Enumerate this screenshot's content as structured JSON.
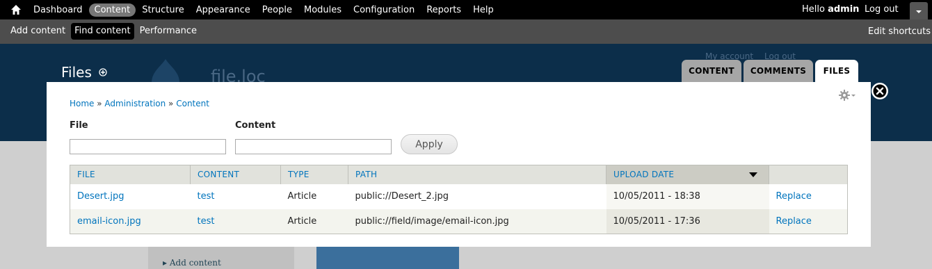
{
  "toolbar": {
    "menu": [
      "Dashboard",
      "Content",
      "Structure",
      "Appearance",
      "People",
      "Modules",
      "Configuration",
      "Reports",
      "Help"
    ],
    "active_index": 1,
    "hello": "Hello ",
    "username": "admin",
    "logout": "Log out"
  },
  "shortcuts": {
    "items": [
      "Add content",
      "Find content",
      "Performance"
    ],
    "edit": "Edit shortcuts"
  },
  "page": {
    "title": "Files",
    "site_name": "file.loc",
    "my_account": "My account",
    "log_out": "Log out"
  },
  "tabs": [
    "CONTENT",
    "COMMENTS",
    "FILES"
  ],
  "breadcrumb": [
    "Home",
    "Administration",
    "Content"
  ],
  "breadcrumb_sep": " » ",
  "filters": {
    "file_label": "File",
    "file_value": "",
    "content_label": "Content",
    "content_value": "",
    "apply": "Apply"
  },
  "table": {
    "headers": [
      "FILE",
      "CONTENT",
      "TYPE",
      "PATH",
      "UPLOAD DATE",
      ""
    ],
    "rows": [
      {
        "file": "Desert.jpg",
        "content": "test",
        "type": "Article",
        "path": "public://Desert_2.jpg",
        "date": "10/05/2011 - 18:38",
        "action": "Replace"
      },
      {
        "file": "email-icon.jpg",
        "content": "test",
        "type": "Article",
        "path": "public://field/image/email-icon.jpg",
        "date": "10/05/2011 - 17:36",
        "action": "Replace"
      }
    ]
  },
  "under_page": {
    "sidebar_link": "Add content"
  },
  "colors": {
    "toolbar_bg": "#000000",
    "shortcuts_bg": "#4d4d4d",
    "header_bg": "#0c2e4a",
    "link": "#0074bd"
  }
}
